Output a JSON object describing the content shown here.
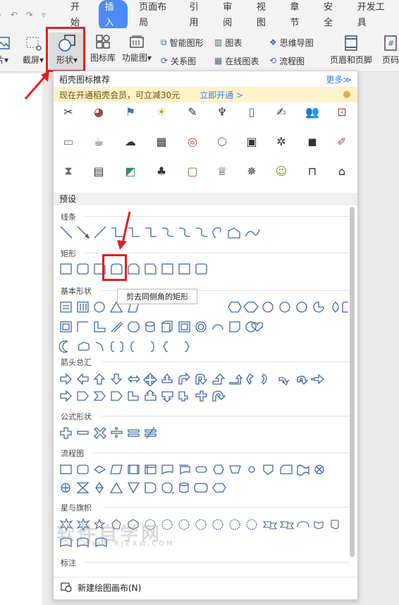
{
  "tabs": [
    "开始",
    "插入",
    "页面布局",
    "引用",
    "审阅",
    "视图",
    "章节",
    "安全",
    "开发工具"
  ],
  "active_tab": "插入",
  "ribbon": {
    "picture_label": "片▾",
    "screenshot_label": "截屏▾",
    "shape_label": "形状▾",
    "iconlib_label": "图标库",
    "funcchart_label": "功能图▾",
    "smartart_label": "智能图形",
    "chart_label": "图表",
    "mindmap_label": "思维导图",
    "relation_label": "关系图",
    "onlinechart_label": "在线图表",
    "flowchart_label": "流程图",
    "header_footer_label": "页眉和页脚",
    "pagenum_label": "页码"
  },
  "panel": {
    "header_title": "稻壳图标推荐",
    "more_label": "更多≫",
    "promo_text": "现在开通稻壳会员，可立减30元",
    "promo_link": "立即开通 >",
    "preset_label": "预设",
    "sections": [
      "线条",
      "矩形",
      "基本形状",
      "箭头总汇",
      "公式形状",
      "流程图",
      "星与旗帜",
      "标注"
    ],
    "new_canvas": "新建绘图画布(N)",
    "tooltip": "剪去同侧角的矩形"
  },
  "watermark": {
    "main": "软件自学网",
    "sub": "WWW.RJZXW.COM"
  },
  "colors": {
    "accent": "#4b8cf5",
    "highlight": "#e02020",
    "shape_stroke": "#3d6aa0"
  }
}
